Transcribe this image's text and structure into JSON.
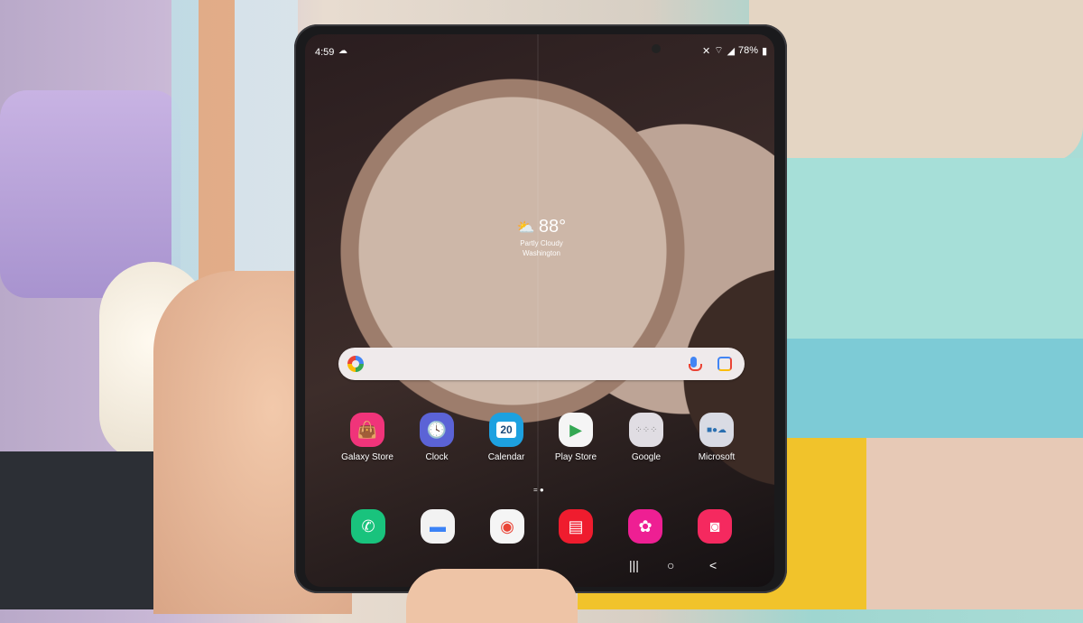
{
  "status_bar": {
    "time": "4:59",
    "weather_icon": "cloud-icon",
    "right_icons": [
      "mute-icon",
      "wifi-icon",
      "signal-icon"
    ],
    "battery": "78%"
  },
  "weather_widget": {
    "icon": "partly-cloudy-icon",
    "temperature": "88°",
    "condition": "Partly Cloudy",
    "location": "Washington"
  },
  "search_bar": {
    "icons": [
      "google-logo-icon",
      "microphone-icon",
      "lens-icon"
    ]
  },
  "apps": [
    {
      "label": "Galaxy Store",
      "icon": "shopping-bag-icon",
      "color": "#f0347a"
    },
    {
      "label": "Clock",
      "icon": "clock-icon",
      "color": "#5b63d6"
    },
    {
      "label": "Calendar",
      "icon": "calendar-icon",
      "color": "#1da1e0",
      "date": "20"
    },
    {
      "label": "Play Store",
      "icon": "play-store-icon",
      "color": "#f5f5f5"
    },
    {
      "label": "Google",
      "icon": "folder-icon",
      "color": "#e0dde3"
    },
    {
      "label": "Microsoft",
      "icon": "folder-icon",
      "color": "#d9dbe4"
    }
  ],
  "dock": [
    {
      "name": "phone",
      "icon": "phone-icon",
      "color": "#19c37d",
      "glyph": "✆"
    },
    {
      "name": "messages",
      "icon": "messages-icon",
      "color": "#f2f2f2",
      "glyph": "💬"
    },
    {
      "name": "chrome",
      "icon": "chrome-icon",
      "color": "#f5f5f5",
      "glyph": "◉"
    },
    {
      "name": "samsung-notes",
      "icon": "notes-icon",
      "color": "#ef1c2e",
      "glyph": "▤"
    },
    {
      "name": "gallery",
      "icon": "gallery-icon",
      "color": "#ee1f93",
      "glyph": "✿"
    },
    {
      "name": "camera",
      "icon": "camera-icon",
      "color": "#f5295f",
      "glyph": "◙"
    }
  ],
  "nav_bar": {
    "recents": "|||",
    "home": "○",
    "back": "<"
  },
  "page_indicator": "= ●"
}
